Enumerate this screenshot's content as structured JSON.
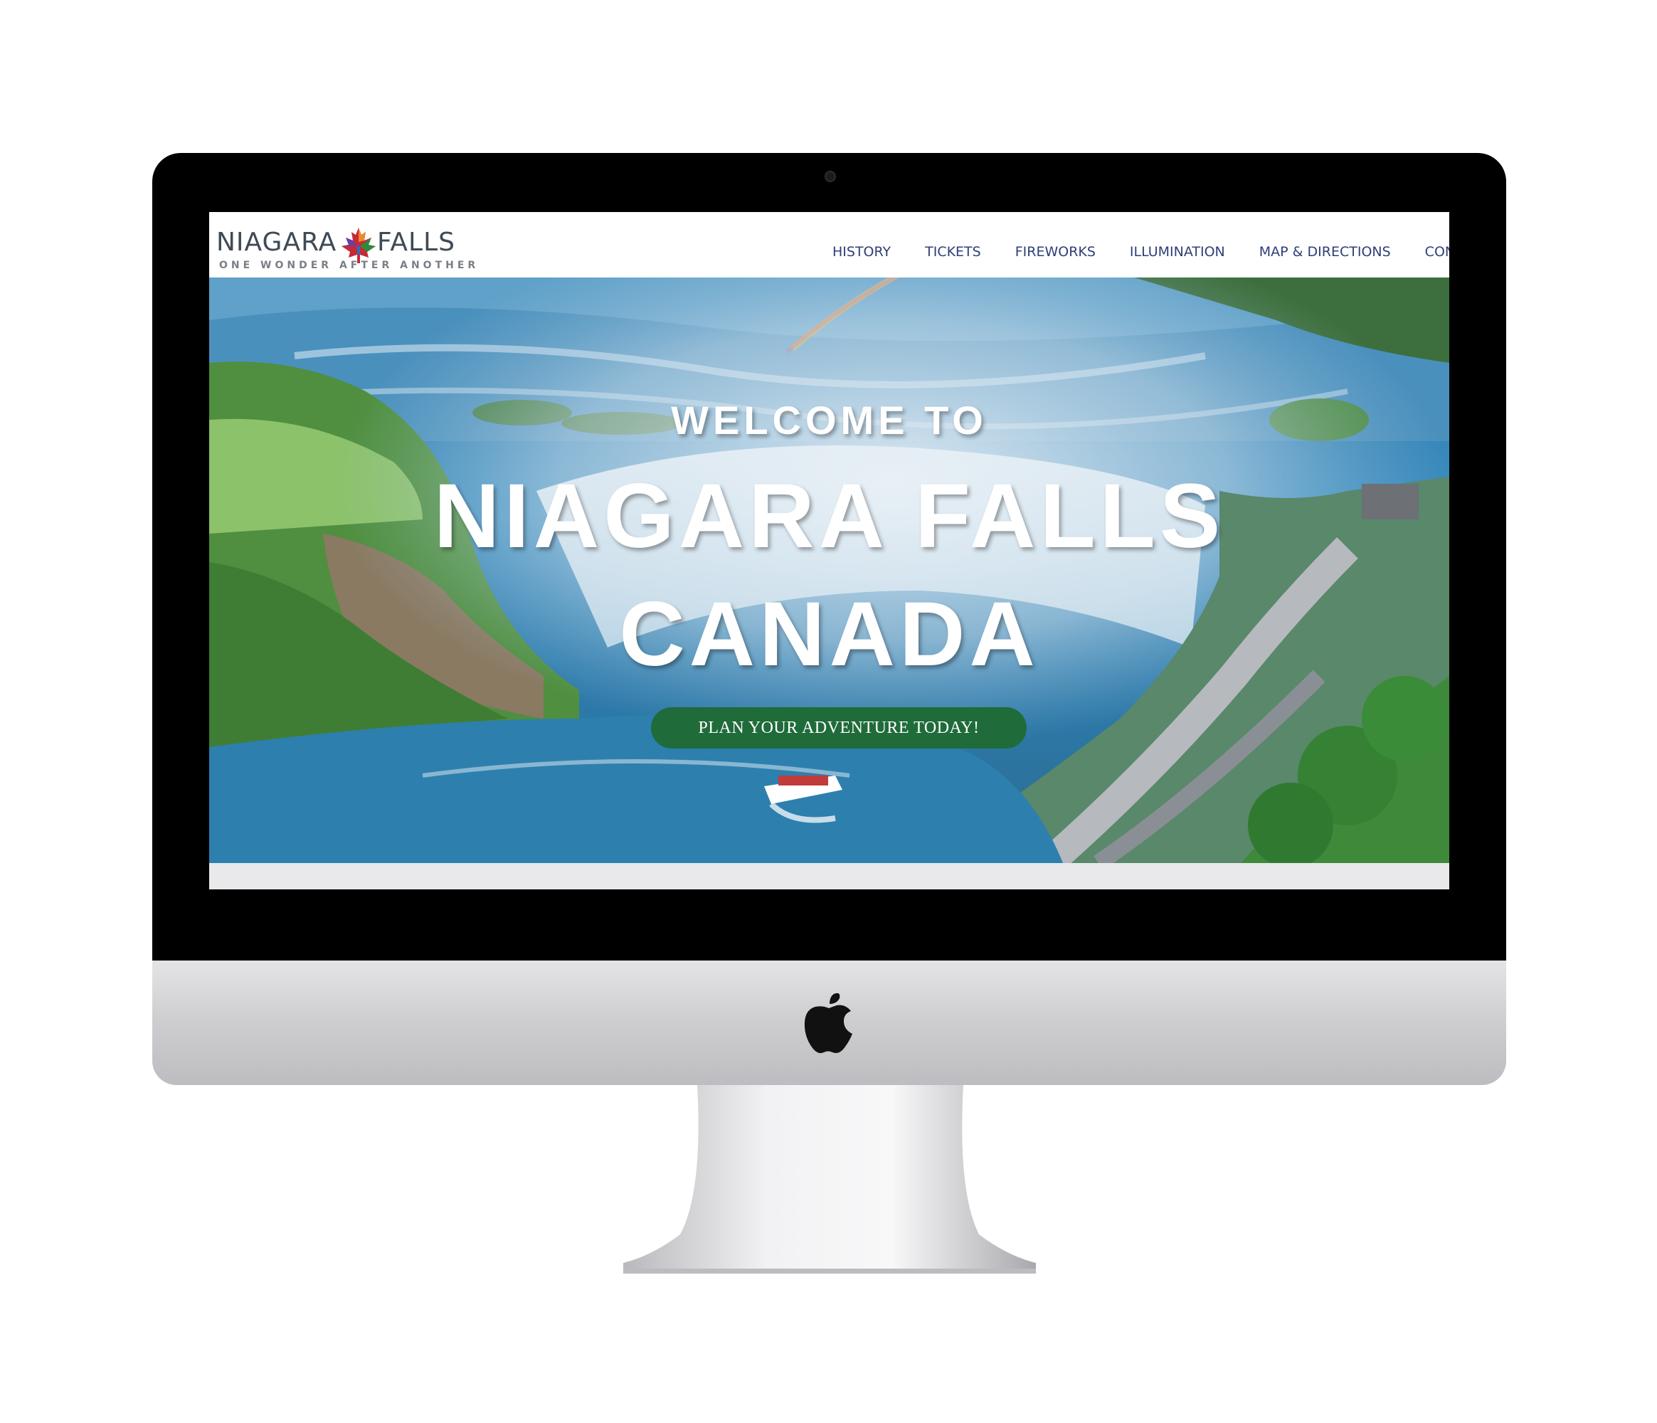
{
  "site": {
    "logo_left": "NIAGARA",
    "logo_right": "FALLS",
    "logo_tagline": "ONE WONDER  AFTER ANOTHER"
  },
  "nav": {
    "items": [
      {
        "label": "HISTORY"
      },
      {
        "label": "TICKETS"
      },
      {
        "label": "FIREWORKS"
      },
      {
        "label": "ILLUMINATION"
      },
      {
        "label": "MAP & DIRECTIONS"
      },
      {
        "label": "CON"
      }
    ],
    "color": "#2f3e78"
  },
  "hero": {
    "welcome": "WELCOME TO",
    "line1": "NIAGARA FALLS",
    "line2": "CANADA",
    "cta_label": "PLAN YOUR ADVENTURE TODAY!",
    "cta_color": "#1f6b3a"
  },
  "device": {
    "logo": "apple-icon"
  }
}
